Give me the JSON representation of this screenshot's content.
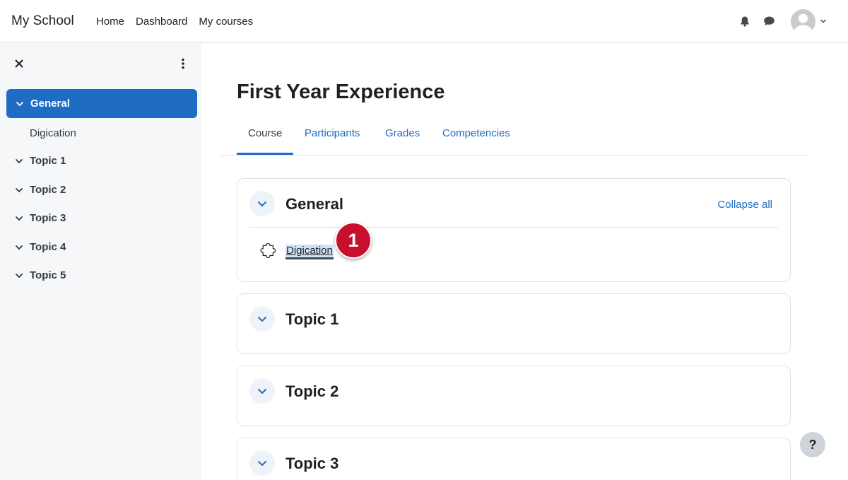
{
  "navbar": {
    "brand": "My School",
    "links": [
      "Home",
      "Dashboard",
      "My courses"
    ],
    "icons": [
      "bell-icon",
      "chat-icon",
      "avatar",
      "chevron-down-icon"
    ]
  },
  "drawer": {
    "items": [
      {
        "label": "General",
        "active": true
      },
      {
        "label": "Digication",
        "sub": true
      },
      {
        "label": "Topic 1"
      },
      {
        "label": "Topic 2"
      },
      {
        "label": "Topic 3"
      },
      {
        "label": "Topic 4"
      },
      {
        "label": "Topic 5"
      }
    ]
  },
  "main": {
    "title": "First Year Experience",
    "tabs": [
      "Course",
      "Participants",
      "Grades",
      "Competencies"
    ],
    "collapse_all": "Collapse all",
    "sections": [
      {
        "title": "General",
        "activity": "Digication"
      },
      {
        "title": "Topic 1"
      },
      {
        "title": "Topic 2"
      },
      {
        "title": "Topic 3"
      }
    ],
    "badge": "1",
    "help": "?"
  },
  "colors": {
    "accent": "#1f6cc4",
    "drawer_bg": "#f5f7f9",
    "badge": "#c8102e"
  }
}
